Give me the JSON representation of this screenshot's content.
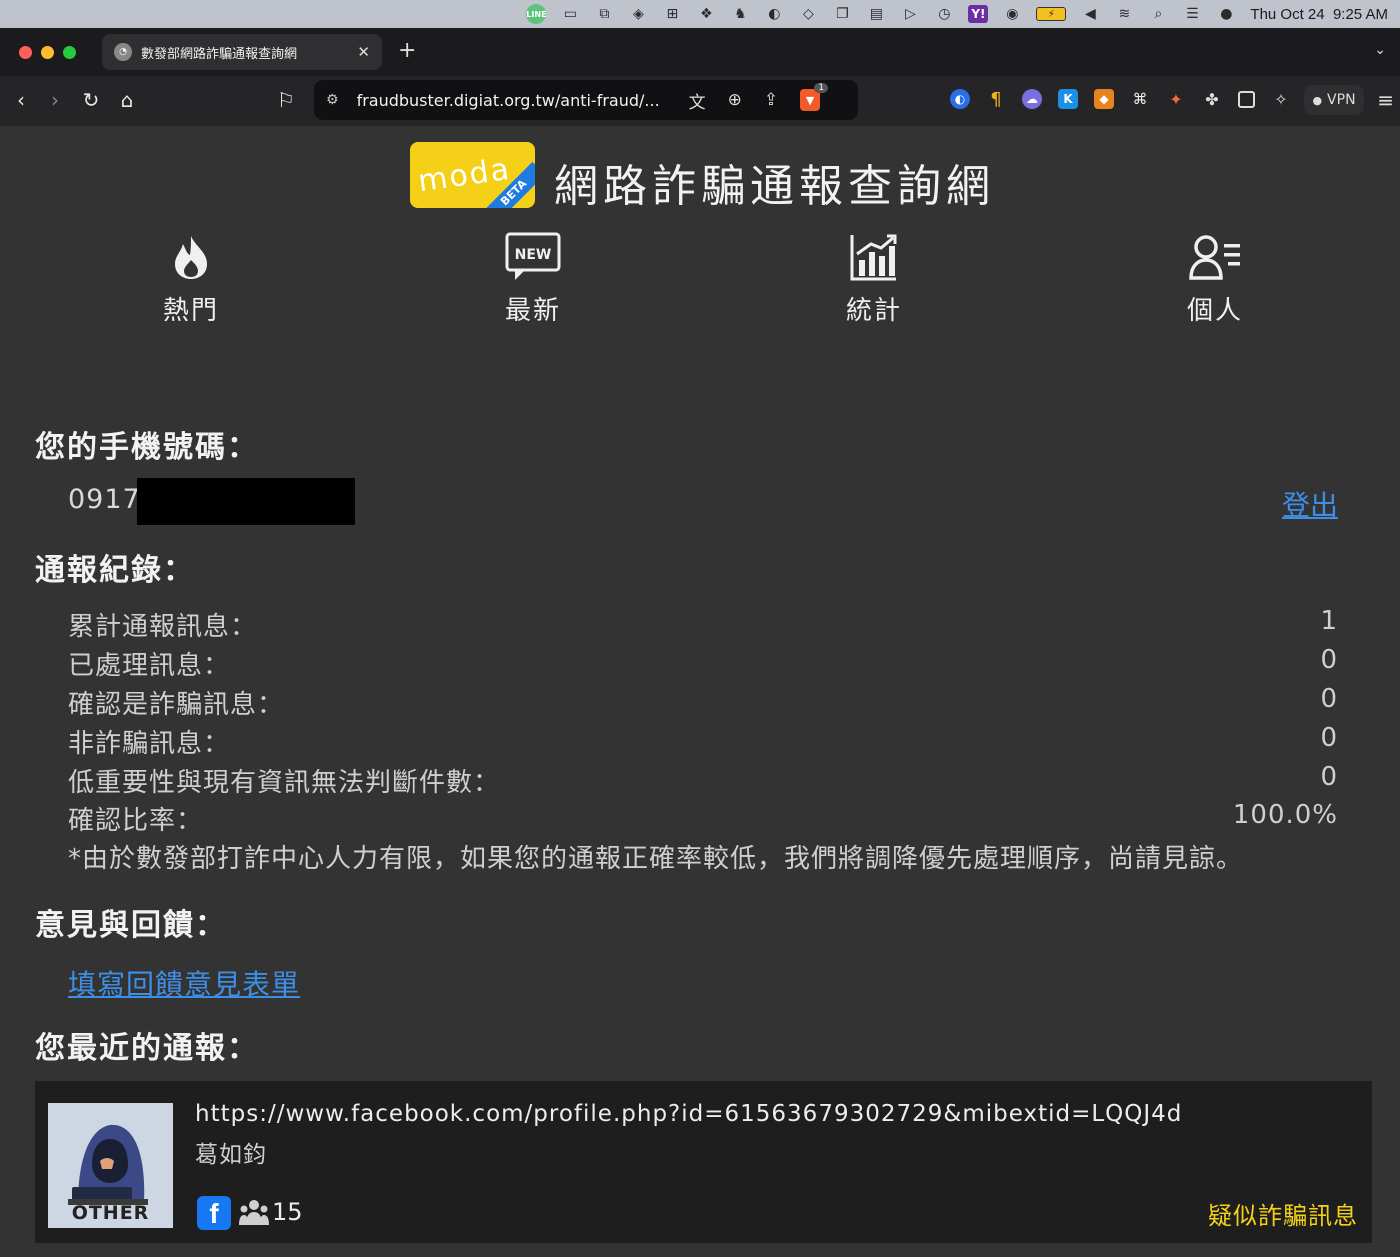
{
  "menubar": {
    "icons": [
      "line-icon",
      "screen-icon",
      "display-icon",
      "layers-icon",
      "grid-icon",
      "dropbox-icon",
      "alpaca-icon",
      "play-circle-icon",
      "stack-icon",
      "window-icon",
      "keyboard-icon",
      "play-icon",
      "history-icon",
      "yahoo-icon",
      "account-icon",
      "battery-icon",
      "volume-icon",
      "wifi-icon",
      "search-icon",
      "control-center-icon",
      "siri-icon"
    ],
    "line_label": "LINE",
    "yahoo_label": "Y!",
    "date": "Thu Oct 24",
    "time": "9:25 AM"
  },
  "browser": {
    "tab_title": "數發部網路詐騙通報查詢網",
    "url": "fraudbuster.digiat.org.tw/anti-fraud/...",
    "shield_badge": "1",
    "vpn_label": "VPN"
  },
  "site": {
    "logo_text": "moda",
    "logo_badge": "BETA",
    "title": "網路詐騙通報查詢網",
    "nav": [
      {
        "label": "熱門",
        "icon": "flame-icon"
      },
      {
        "label": "最新",
        "icon": "new-badge-icon"
      },
      {
        "label": "統計",
        "icon": "chart-icon"
      },
      {
        "label": "個人",
        "icon": "user-list-icon"
      }
    ]
  },
  "profile": {
    "phone_heading": "您的手機號碼：",
    "phone_prefix": "0917",
    "logout_label": "登出"
  },
  "records": {
    "heading": "通報紀錄：",
    "rows": [
      {
        "label": "累計通報訊息：",
        "value": "1"
      },
      {
        "label": "已處理訊息：",
        "value": "0"
      },
      {
        "label": "確認是詐騙訊息：",
        "value": "0"
      },
      {
        "label": "非詐騙訊息：",
        "value": "0"
      },
      {
        "label": "低重要性與現有資訊無法判斷件數：",
        "value": "0"
      },
      {
        "label": "確認比率：",
        "value": "100.0%"
      }
    ],
    "note": "*由於數發部打詐中心人力有限，如果您的通報正確率較低，我們將調降優先處理順序，尚請見諒。"
  },
  "feedback": {
    "heading": "意見與回饋：",
    "link_label": "填寫回饋意見表單"
  },
  "recent": {
    "heading": "您最近的通報：",
    "report": {
      "thumb_tag": "OTHER",
      "url": "https://www.facebook.com/profile.php?id=61563679302729&mibextid=LQQJ4d",
      "name": "葛如鈞",
      "fb_letter": "f",
      "count": "15",
      "status": "疑似詐騙訊息"
    }
  },
  "colors": {
    "page_bg": "#333333",
    "link": "#3d8fe6",
    "status_yellow": "#f4d118",
    "card_bg": "#1e1e1e",
    "logo_yellow": "#f4d118",
    "beta_blue": "#1e7be0"
  }
}
